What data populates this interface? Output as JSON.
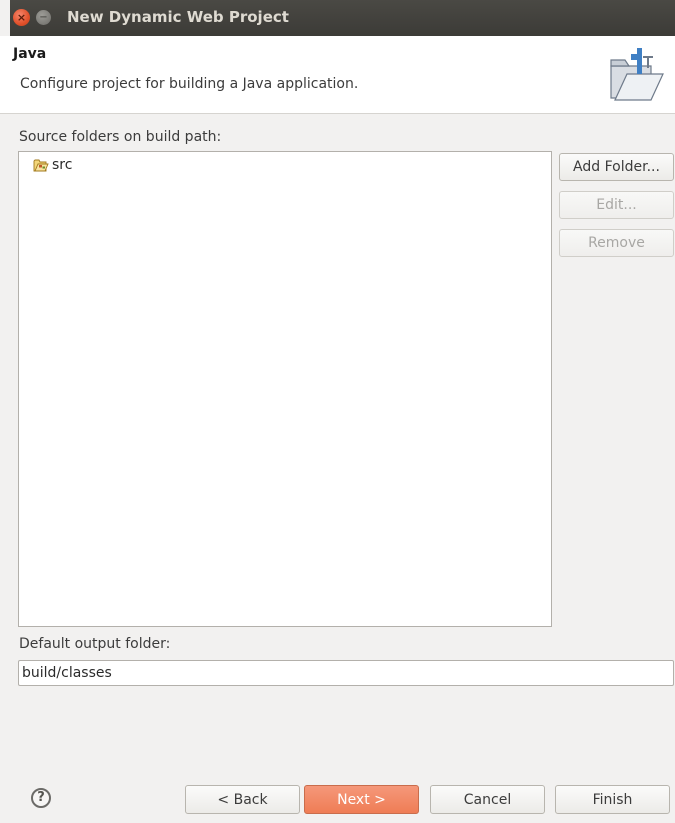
{
  "window": {
    "title": "New Dynamic Web Project",
    "close_glyph": "×",
    "min_glyph": "−"
  },
  "banner": {
    "title": "Java",
    "description": "Configure project for building a Java application.",
    "icon": "folder-wizard-icon"
  },
  "source_folders": {
    "label": "Source folders on build path:",
    "items": [
      {
        "label": "src",
        "icon": "source-folder-icon"
      }
    ],
    "buttons": {
      "add_folder": "Add Folder...",
      "edit": "Edit...",
      "remove": "Remove"
    }
  },
  "output": {
    "label": "Default output folder:",
    "value": "build/classes"
  },
  "footer": {
    "help_glyph": "?",
    "back": "< Back",
    "next": "Next >",
    "cancel": "Cancel",
    "finish": "Finish"
  },
  "colors": {
    "titlebar": "#3c3b37",
    "primary_button": "#ef7d55",
    "window_bg": "#f2f1f0"
  }
}
